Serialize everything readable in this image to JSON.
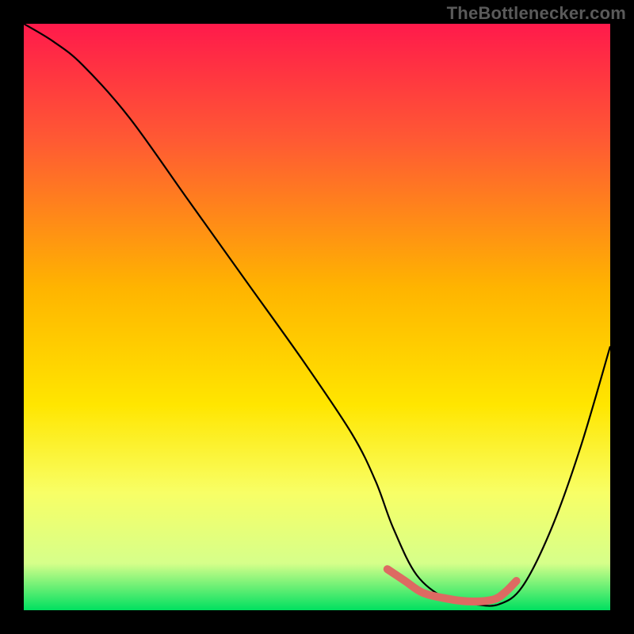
{
  "attribution": "TheBottlenecker.com",
  "chart_data": {
    "type": "line",
    "title": "",
    "xlabel": "",
    "ylabel": "",
    "xlim": [
      0,
      100
    ],
    "ylim": [
      0,
      100
    ],
    "background_gradient": {
      "stops": [
        {
          "offset": 0,
          "color": "#ff1a4b"
        },
        {
          "offset": 20,
          "color": "#ff5a33"
        },
        {
          "offset": 45,
          "color": "#ffb400"
        },
        {
          "offset": 65,
          "color": "#ffe600"
        },
        {
          "offset": 80,
          "color": "#f8ff66"
        },
        {
          "offset": 92,
          "color": "#d6ff8a"
        },
        {
          "offset": 100,
          "color": "#00e060"
        }
      ]
    },
    "series": [
      {
        "name": "bottleneck-curve",
        "color": "#000000",
        "x": [
          0,
          5,
          10,
          18,
          28,
          38,
          48,
          56,
          60,
          63,
          67,
          72,
          77,
          81,
          85,
          90,
          95,
          100
        ],
        "y": [
          100,
          97,
          93,
          84,
          70,
          56,
          42,
          30,
          22,
          14,
          6,
          2,
          1,
          1,
          4,
          14,
          28,
          45
        ]
      },
      {
        "name": "optimal-range-highlight",
        "color": "#dd6a62",
        "stroke_width_px": 10,
        "x": [
          62,
          65,
          68,
          72,
          76,
          80,
          82,
          84
        ],
        "y": [
          7,
          5,
          3,
          2,
          1.5,
          1.8,
          3,
          5
        ]
      }
    ]
  }
}
